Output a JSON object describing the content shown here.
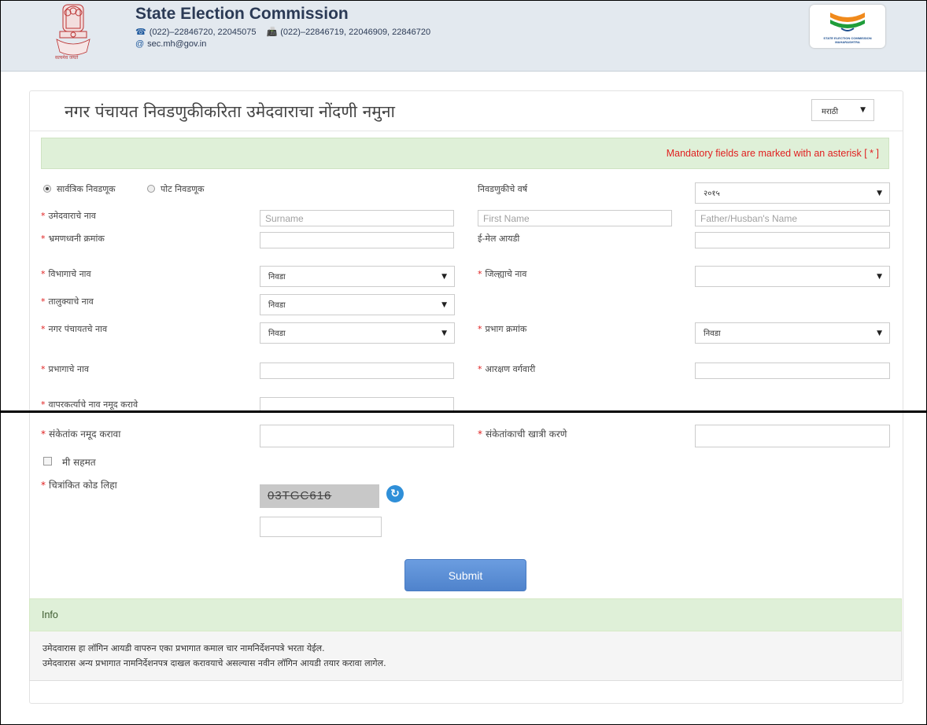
{
  "header": {
    "title": "State Election Commission",
    "phone": "(022)–22846720, 22045075",
    "fax": "(022)–22846719, 22046909, 22846720",
    "email": "sec.mh@gov.in",
    "emblem_motto": "सत्यमेव जयते",
    "logo_text": "STATE ELECTION COMMISSION MAHARASHTRA"
  },
  "form": {
    "title": "नगर पंचायत निवडणुकीकरिता उमेदवाराचा नोंदणी नमुना",
    "language": "मराठी",
    "mandatory_note": "Mandatory fields are marked with an asterisk [ * ]",
    "election_type": {
      "options": [
        "सार्वत्रिक निवडणूक",
        "पोट निवडणूक"
      ],
      "selected": "सार्वत्रिक निवडणूक"
    },
    "election_year_label": "निवडणुकीचे वर्ष",
    "election_year": "२०१५",
    "candidate_name_label": "उमेदवाराचे नाव",
    "surname_placeholder": "Surname",
    "firstname_placeholder": "First Name",
    "father_placeholder": "Father/Husban's Name",
    "mobile_label": "भ्रमणध्वनी क्रमांक",
    "email_label": "ई-मेल आयडी",
    "division_label": "विभागाचे नाव",
    "division_value": "निवडा",
    "district_label": "जिल्ह्याचे नाव",
    "district_value": "",
    "taluka_label": "तालुक्याचे नाव",
    "taluka_value": "निवडा",
    "nagar_panchayat_label": "नगर पंचायतचे नाव",
    "nagar_panchayat_value": "निवडा",
    "ward_no_label": "प्रभाग क्रमांक",
    "ward_no_value": "निवडा",
    "ward_name_label": "प्रभागाचे नाव",
    "reservation_label": "आरक्षण वर्गवारी",
    "username_label": "वापरकर्त्याचे नाव नमूद करावे",
    "password_label": "संकेतांक नमूद करावा",
    "confirm_password_label": "संकेतांकाची खात्री करणे",
    "agree_label": "मी सहमत",
    "captcha_label": "चित्रांकित कोड लिहा",
    "captcha_code": "03TGC616",
    "submit_label": "Submit",
    "required_mark": "*"
  },
  "info": {
    "heading": "Info",
    "line1": "उमेदवारास हा लॉगिन आयडी वापरुन एका प्रभागात कमाल चार नामनिर्देशनपत्रे भरता येईल.",
    "line2": "उमेदवारास अन्य प्रभागात नामनिर्देशनपत्र दाखल करावयाचे असल्यास नवीन लॉगिन आयडी तयार करावा लागेल."
  },
  "icons": {
    "phone": "phone-icon",
    "fax": "fax-icon",
    "email": "at-icon",
    "refresh": "refresh-icon",
    "caret": "caret-down-icon"
  },
  "colors": {
    "header_bg": "#e3e9ef",
    "alert_bg": "#dff0d8",
    "required": "#e02020",
    "submit": "#5b8fd6"
  }
}
